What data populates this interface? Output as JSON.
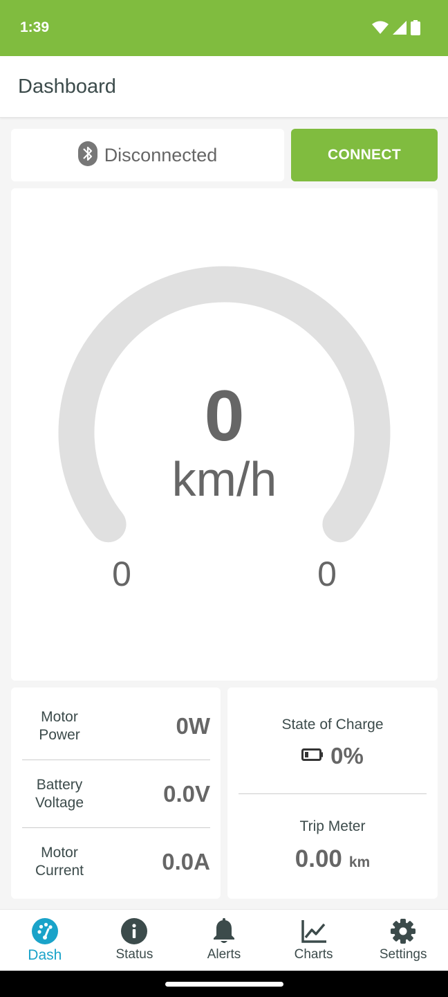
{
  "status_bar": {
    "time": "1:39",
    "icons": [
      "wifi-icon",
      "cell-signal-icon",
      "battery-icon"
    ],
    "background": "#80bc3f"
  },
  "app_bar": {
    "title": "Dashboard"
  },
  "connection": {
    "status": "Disconnected",
    "icon": "bluetooth-icon",
    "button_label": "CONNECT",
    "accent": "#80bc3f"
  },
  "gauge": {
    "speed": "0",
    "unit": "km/h",
    "min_label": "0",
    "max_label": "0",
    "fill_fraction": 0,
    "track_color": "#e0e0e0"
  },
  "metrics": [
    {
      "label": "Motor Power",
      "value": "0W"
    },
    {
      "label": "Battery Voltage",
      "value": "0.0V"
    },
    {
      "label": "Motor Current",
      "value": "0.0A"
    }
  ],
  "state_of_charge": {
    "label": "State of Charge",
    "value": "0%",
    "icon": "battery-empty-icon"
  },
  "trip_meter": {
    "label": "Trip Meter",
    "value": "0.00",
    "unit": "km"
  },
  "bottom_nav": {
    "active": "Dash",
    "active_color": "#1aa3c9",
    "items": [
      {
        "label": "Dash",
        "icon": "dashboard-icon"
      },
      {
        "label": "Status",
        "icon": "info-icon"
      },
      {
        "label": "Alerts",
        "icon": "bell-icon"
      },
      {
        "label": "Charts",
        "icon": "chart-icon"
      },
      {
        "label": "Settings",
        "icon": "gear-icon"
      }
    ]
  }
}
